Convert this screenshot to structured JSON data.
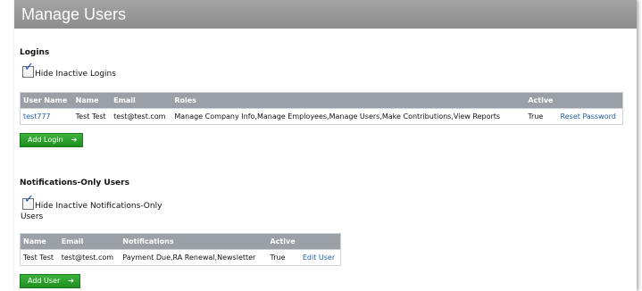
{
  "header": {
    "title": "Manage Users"
  },
  "logins": {
    "section_title": "Logins",
    "hide_inactive_label": "Hide Inactive Logins",
    "hide_inactive_checked": true,
    "columns": [
      "User Name",
      "Name",
      "Email",
      "Roles",
      "Active"
    ],
    "rows": [
      {
        "user_name": "test777",
        "name": "Test Test",
        "email": "test@test.com",
        "roles": "Manage Company Info,Manage Employees,Manage Users,Make Contributions,View Reports",
        "active": "True",
        "action": "Reset Password"
      }
    ],
    "add_button": "Add Login",
    "add_button_icon": "arrow-right-icon"
  },
  "notifications": {
    "section_title": "Notifications-Only Users",
    "hide_inactive_label_line1": "Hide Inactive Notifications-Only",
    "hide_inactive_label_line2": "Users",
    "hide_inactive_checked": true,
    "columns": [
      "Name",
      "Email",
      "Notifications",
      "Active"
    ],
    "rows": [
      {
        "name": "Test Test",
        "email": "test@test.com",
        "notifications": "Payment Due,RA Renewal,Newsletter",
        "active": "True",
        "action": "Edit User"
      }
    ],
    "add_button": "Add User",
    "add_button_icon": "arrow-right-icon"
  },
  "colors": {
    "header_bg": "#999999",
    "table_header_bg": "#9aa0a6",
    "link": "#1f5fa8",
    "button_green": "#2ea02e"
  }
}
